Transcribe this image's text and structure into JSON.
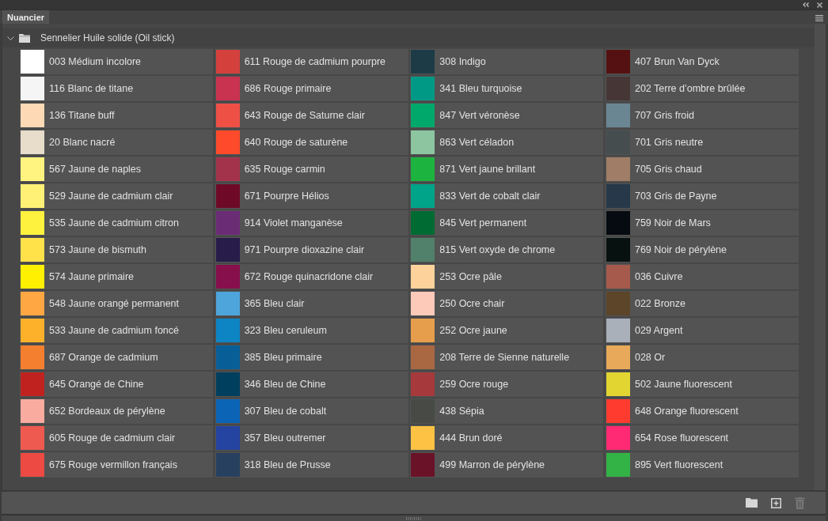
{
  "tabs": [
    {
      "label": "Nuancier",
      "selected": true
    }
  ],
  "groups": [
    {
      "name": "Sennelier Huile solide (Oil stick)",
      "expanded": true,
      "swatches": [
        {
          "name": "003 Médium incolore",
          "color": "#ffffff"
        },
        {
          "name": "116 Blanc de titane",
          "color": "#f5f5f5"
        },
        {
          "name": "136 Titane buff",
          "color": "#fdd9b5"
        },
        {
          "name": "20 Blanc nacré",
          "color": "#e8dccb"
        },
        {
          "name": "567 Jaune de naples",
          "color": "#fff47f"
        },
        {
          "name": "529 Jaune de cadmium clair",
          "color": "#fff176"
        },
        {
          "name": "535 Jaune de cadmium citron",
          "color": "#fff23f"
        },
        {
          "name": "573 Jaune de bismuth",
          "color": "#ffe14a"
        },
        {
          "name": "574 Jaune primaire",
          "color": "#ffef00"
        },
        {
          "name": "548 Jaune orangé permanent",
          "color": "#ffa743"
        },
        {
          "name": "533 Jaune de cadmium foncé",
          "color": "#fdb12a"
        },
        {
          "name": "687 Orange de cadmium",
          "color": "#f4802f"
        },
        {
          "name": "645 Orangé de Chine",
          "color": "#c0231f"
        },
        {
          "name": "652 Bordeaux de pérylène",
          "color": "#f9aba0"
        },
        {
          "name": "605 Rouge de cadmium clair",
          "color": "#ee5a4f"
        },
        {
          "name": "675 Rouge vermillon français",
          "color": "#ec4a43"
        },
        {
          "name": "611 Rouge de cadmium pourpre",
          "color": "#d4403c"
        },
        {
          "name": "686 Rouge primaire",
          "color": "#c9334f"
        },
        {
          "name": "643 Rouge de Saturne clair",
          "color": "#ee5045"
        },
        {
          "name": "640 Rouge de saturène",
          "color": "#ff4a2b"
        },
        {
          "name": "635 Rouge carmin",
          "color": "#a3334b"
        },
        {
          "name": "671 Pourpre Hélios",
          "color": "#6e0a27"
        },
        {
          "name": "914 Violet manganèse",
          "color": "#6b2c76"
        },
        {
          "name": "971 Pourpre dioxazine clair",
          "color": "#271c4a"
        },
        {
          "name": "672 Rouge quinacridone clair",
          "color": "#860f4c"
        },
        {
          "name": "365 Bleu clair",
          "color": "#4ea5db"
        },
        {
          "name": "323 Bleu ceruleum",
          "color": "#0d84c3"
        },
        {
          "name": "385 Bleu primaire",
          "color": "#085f98"
        },
        {
          "name": "346 Bleu de Chine",
          "color": "#013f5e"
        },
        {
          "name": "307 Bleu de cobalt",
          "color": "#0b64b5"
        },
        {
          "name": "357 Bleu outremer",
          "color": "#2543a0"
        },
        {
          "name": "318 Bleu de Prusse",
          "color": "#27405f"
        },
        {
          "name": "308 Indigo",
          "color": "#1c3b47"
        },
        {
          "name": "341 Bleu turquoise",
          "color": "#009985"
        },
        {
          "name": "847 Vert véronèse",
          "color": "#00a86b"
        },
        {
          "name": "863 Vert céladon",
          "color": "#8cc5a0"
        },
        {
          "name": "871 Vert jaune brillant",
          "color": "#1db33f"
        },
        {
          "name": "833 Vert de cobalt clair",
          "color": "#00a488"
        },
        {
          "name": "845 Vert permanent",
          "color": "#006b32"
        },
        {
          "name": "815 Vert oxyde de chrome",
          "color": "#51816a"
        },
        {
          "name": "253 Ocre pâle",
          "color": "#fed39b"
        },
        {
          "name": "250 Ocre chair",
          "color": "#fdcab9"
        },
        {
          "name": "252 Ocre jaune",
          "color": "#e79e4c"
        },
        {
          "name": "208 Terre de Sienne naturelle",
          "color": "#a96842"
        },
        {
          "name": "259 Ocre rouge",
          "color": "#a5393b"
        },
        {
          "name": "438 Sépia",
          "color": "#474a45"
        },
        {
          "name": "444 Brun doré",
          "color": "#fdc244"
        },
        {
          "name": "499 Marron de pérylène",
          "color": "#6a1228"
        },
        {
          "name": "407 Brun Van Dyck",
          "color": "#551111"
        },
        {
          "name": "202 Terre d’ombre brûlée",
          "color": "#473636"
        },
        {
          "name": "707 Gris froid",
          "color": "#6a8693"
        },
        {
          "name": "701 Gris neutre",
          "color": "#454d4f"
        },
        {
          "name": "705 Gris chaud",
          "color": "#9f7d66"
        },
        {
          "name": "703 Gris de Payne",
          "color": "#263849"
        },
        {
          "name": "759 Noir de Mars",
          "color": "#050b10"
        },
        {
          "name": "769 Noir de pérylène",
          "color": "#07110f"
        },
        {
          "name": "036 Cuivre",
          "color": "#a55a4b"
        },
        {
          "name": "022 Bronze",
          "color": "#5c4529"
        },
        {
          "name": "029 Argent",
          "color": "#a9b0ba"
        },
        {
          "name": "028 Or",
          "color": "#e8aa5a"
        },
        {
          "name": "502 Jaune fluorescent",
          "color": "#e2d532"
        },
        {
          "name": "648 Orange fluorescent",
          "color": "#ff3b30"
        },
        {
          "name": "654 Rose fluorescent",
          "color": "#ff2a73"
        },
        {
          "name": "895 Vert fluorescent",
          "color": "#33b245"
        }
      ]
    }
  ],
  "toolbar": {
    "new_group": {
      "disabled": false
    },
    "new_swatch": {
      "disabled": false
    },
    "delete": {
      "disabled": true
    }
  }
}
